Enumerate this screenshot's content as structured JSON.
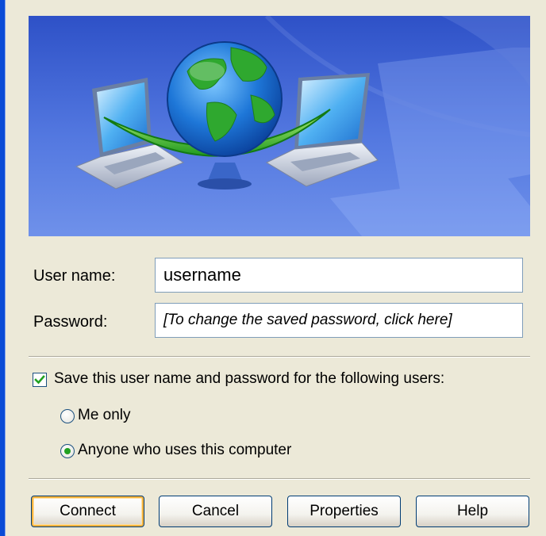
{
  "form": {
    "username_label": "User name:",
    "username_value": "username",
    "password_label": "Password:",
    "password_placeholder": "[To change the saved password, click here]",
    "save_checkbox_label": "Save this user name and password for the following users:",
    "save_checked": true,
    "radio_options": [
      {
        "label": "Me only",
        "selected": false
      },
      {
        "label": "Anyone who uses this computer",
        "selected": true
      }
    ]
  },
  "buttons": {
    "connect": "Connect",
    "cancel": "Cancel",
    "properties": "Properties",
    "help": "Help"
  },
  "colors": {
    "window_bg": "#ece9d8",
    "accent_border": "#0a4bd6",
    "banner_blue": "#3b62d6",
    "check_green": "#21a121",
    "default_button_glow": "#f8b33c"
  },
  "icons": {
    "banner": "network-globe-laptops-illustration",
    "checkbox": "checkmark-icon",
    "radio_selected": "radio-dot-icon"
  }
}
